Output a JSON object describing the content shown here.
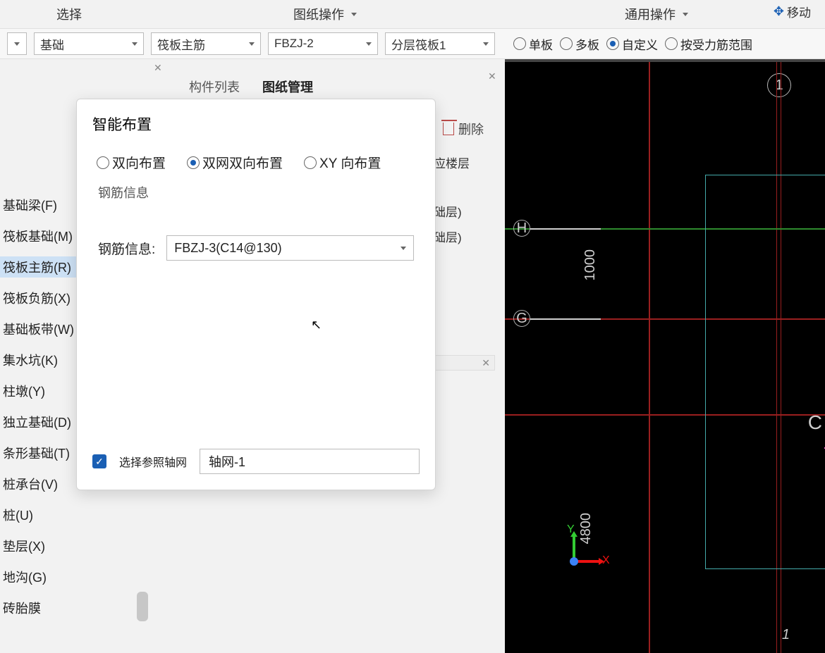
{
  "topmenu": {
    "select": "选择",
    "drawing_ops": "图纸操作",
    "general_ops": "通用操作",
    "move": "移动"
  },
  "selectors": {
    "cat": "基础",
    "rebar": "筏板主筋",
    "code": "FBZJ-2",
    "layer": "分层筏板1"
  },
  "radios": {
    "single": "单板",
    "multi": "多板",
    "custom": "自定义",
    "byforce": "按受力筋范围"
  },
  "tabs": {
    "component_list": "构件列表",
    "drawing_mgmt": "图纸管理"
  },
  "actions": {
    "delete": "删除"
  },
  "floors": {
    "a": "基础层)",
    "b": "基础层)",
    "note": "对应楼层"
  },
  "left_categories": [
    "基础梁(F)",
    "筏板基础(M)",
    "筏板主筋(R)",
    "筏板负筋(X)",
    "基础板带(W)",
    "集水坑(K)",
    "柱墩(Y)",
    "独立基础(D)",
    "条形基础(T)",
    "桩承台(V)",
    "桩(U)",
    "垫层(X)",
    "地沟(G)",
    "砖胎膜"
  ],
  "dialog": {
    "title": "智能布置",
    "opt_two_dir": "双向布置",
    "opt_double_net": "双网双向布置",
    "opt_xy": "XY 向布置",
    "group": "钢筋信息",
    "field_label": "钢筋信息:",
    "field_value": "FBZJ-3(C14@130)",
    "checkbox_label": "选择参照轴网",
    "axis_value": "轴网-1"
  },
  "canvas": {
    "top_axis": "1",
    "h_label": "H",
    "g_label": "G",
    "dim_1000": "1000",
    "dim_4800": "4800",
    "x": "X",
    "y": "Y",
    "bigC": "C",
    "bottom_num": "1"
  }
}
